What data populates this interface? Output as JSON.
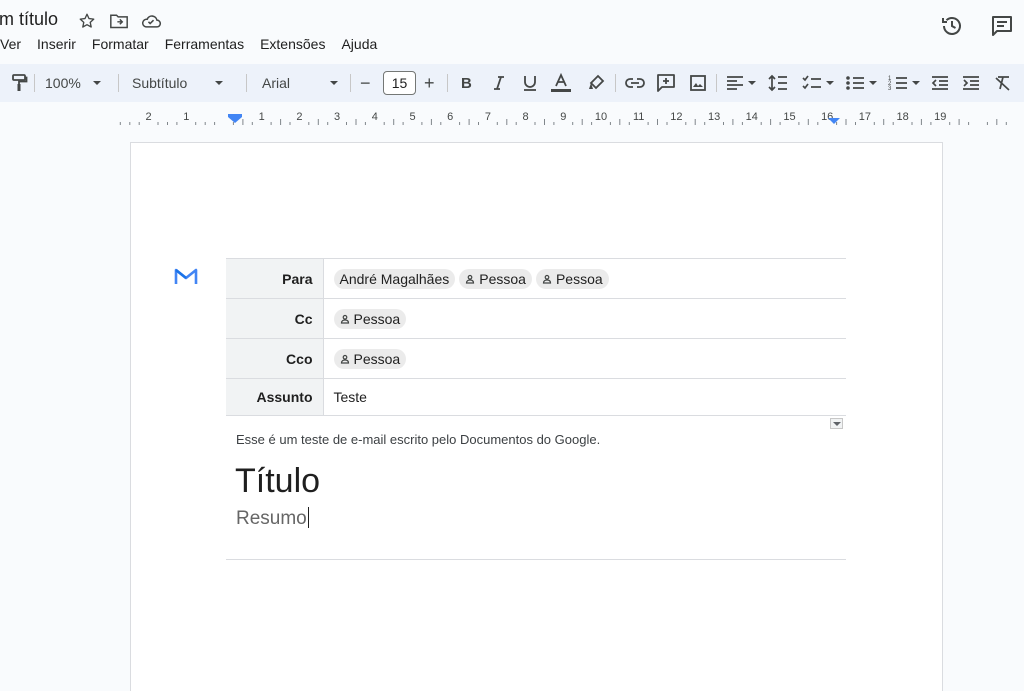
{
  "document": {
    "title": "m título"
  },
  "menu": {
    "items": [
      "Ver",
      "Inserir",
      "Formatar",
      "Ferramentas",
      "Extensões",
      "Ajuda"
    ]
  },
  "toolbar": {
    "zoom": "100%",
    "style": "Subtítulo",
    "font": "Arial",
    "font_size": "15",
    "minus": "−",
    "plus": "+"
  },
  "ruler": {
    "labels_left": [
      "2",
      "1"
    ],
    "labels_right": [
      "1",
      "2",
      "3",
      "4",
      "5",
      "6",
      "7",
      "8",
      "9",
      "10",
      "11",
      "12",
      "13",
      "14",
      "15",
      "16",
      "17",
      "18",
      "19"
    ]
  },
  "email": {
    "rows": [
      {
        "label": "Para",
        "chips": [
          {
            "text": "André Magalhães",
            "person_icon": false
          },
          {
            "text": "Pessoa",
            "person_icon": true
          },
          {
            "text": "Pessoa",
            "person_icon": true
          }
        ]
      },
      {
        "label": "Cc",
        "chips": [
          {
            "text": "Pessoa",
            "person_icon": true
          }
        ]
      },
      {
        "label": "Cco",
        "chips": [
          {
            "text": "Pessoa",
            "person_icon": true
          }
        ]
      },
      {
        "label": "Assunto",
        "value": "Teste"
      }
    ],
    "body": "Esse é um teste de e-mail escrito pelo Documentos do Google.",
    "heading_title": "Título",
    "heading_subtitle": "Resumo"
  },
  "colors": {
    "accent": "#4285f4",
    "toolbar_bg": "#edf2fa",
    "label_bg": "#f1f3f4"
  }
}
